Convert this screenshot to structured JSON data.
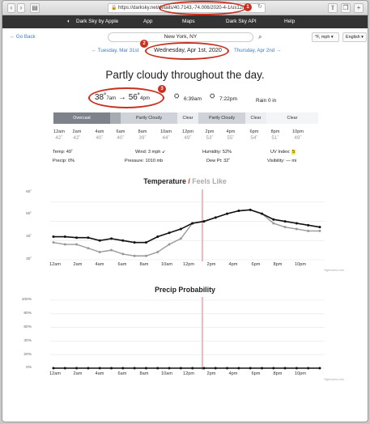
{
  "browser": {
    "url": "https://darksky.net/details/40.7143,-74.006/2020-4-1/us12/en"
  },
  "nav": {
    "brand": "Dark Sky by Apple",
    "items": [
      "App",
      "Maps",
      "Dark Sky API",
      "Help"
    ]
  },
  "toolbar": {
    "go_back": "← Go Back",
    "location": "New York, NY",
    "units": "°F, mph",
    "language": "English"
  },
  "dates": {
    "prev": "← Tuesday, Mar 31st",
    "current": "Wednesday, Apr 1st, 2020",
    "next": "Thursday, Apr 2nd →"
  },
  "annotations": {
    "b1": "1",
    "b2": "2",
    "b3": "3"
  },
  "summary": "Partly cloudy throughout the day.",
  "temp_range": {
    "low": "38˚",
    "low_time": "7am",
    "arrow": "→",
    "high": "56˚",
    "high_time": "4pm"
  },
  "sun": {
    "sunrise": "6:39am",
    "sunset": "7:22pm"
  },
  "rain": {
    "label": "Rain",
    "value": "0 in"
  },
  "cloud_segments": [
    "Overcast",
    "Partly Cloudy",
    "Clear",
    "Partly Cloudy",
    "Clear",
    "Clear"
  ],
  "hours": [
    "12am",
    "2am",
    "4am",
    "6am",
    "8am",
    "10am",
    "12pm",
    "2pm",
    "4pm",
    "6pm",
    "8pm",
    "10pm"
  ],
  "hourly_temps": [
    "42˚",
    "42˚",
    "40˚",
    "40˚",
    "39˚",
    "44˚",
    "49˚",
    "53˚",
    "55˚",
    "54˚",
    "51˚",
    "49˚"
  ],
  "stats": {
    "temp_label": "Temp:",
    "temp": "49˚",
    "precip_label": "Precip:",
    "precip": "0%",
    "wind_label": "Wind:",
    "wind": "3 mph ↙",
    "pressure_label": "Pressure:",
    "pressure": "1010 mb",
    "humidity_label": "Humidity:",
    "humidity": "52%",
    "dew_label": "Dew Pt:",
    "dew": "32˚",
    "uv_label": "UV Index:",
    "uv": "5",
    "vis_label": "Visibility:",
    "vis": "— mi"
  },
  "temp_chart": {
    "title_temp": "Temperature",
    "title_sep": " / ",
    "title_feels": "Feels Like",
    "y_ticks": [
      "60˚",
      "50˚",
      "40˚",
      "30˚"
    ],
    "credit": "Highcharts.com"
  },
  "precip_chart": {
    "title": "Precip Probability",
    "y_ticks": [
      "100%",
      "80%",
      "60%",
      "40%",
      "20%",
      "0%"
    ],
    "credit": "Highcharts.com"
  },
  "chart_data": [
    {
      "type": "line",
      "title": "Temperature / Feels Like",
      "x": [
        "12am",
        "1am",
        "2am",
        "3am",
        "4am",
        "5am",
        "6am",
        "7am",
        "8am",
        "9am",
        "10am",
        "11am",
        "12pm",
        "1pm",
        "2pm",
        "3pm",
        "4pm",
        "5pm",
        "6pm",
        "7pm",
        "8pm",
        "9pm",
        "10pm",
        "11pm"
      ],
      "ylim": [
        30,
        65
      ],
      "series": [
        {
          "name": "Temperature",
          "color": "#111111",
          "values": [
            42,
            42,
            41.5,
            41.5,
            40,
            41,
            40,
            39,
            39,
            42,
            44,
            46,
            49,
            50,
            52,
            54,
            55.5,
            56,
            54,
            51,
            50,
            49,
            48,
            47
          ]
        },
        {
          "name": "Feels Like",
          "color": "#9a9a9a",
          "values": [
            39,
            38,
            38,
            36,
            34,
            35,
            33,
            32,
            32,
            34,
            38,
            41,
            49,
            50,
            52,
            54,
            55.5,
            56,
            54,
            49,
            47,
            46,
            45,
            45
          ]
        }
      ],
      "annotation_line_at": "1pm",
      "grid": true
    },
    {
      "type": "line",
      "title": "Precip Probability",
      "x": [
        "12am",
        "1am",
        "2am",
        "3am",
        "4am",
        "5am",
        "6am",
        "7am",
        "8am",
        "9am",
        "10am",
        "11am",
        "12pm",
        "1pm",
        "2pm",
        "3pm",
        "4pm",
        "5pm",
        "6pm",
        "7pm",
        "8pm",
        "9pm",
        "10pm",
        "11pm"
      ],
      "ylim": [
        0,
        100
      ],
      "series": [
        {
          "name": "Precip Probability",
          "color": "#111111",
          "values": [
            0,
            0,
            0,
            0,
            0,
            0,
            0,
            0,
            0,
            0,
            0,
            0,
            0,
            0,
            0,
            0,
            0,
            0,
            0,
            0,
            0,
            0,
            0,
            0
          ]
        }
      ],
      "annotation_line_at": "1pm",
      "grid": true
    }
  ]
}
